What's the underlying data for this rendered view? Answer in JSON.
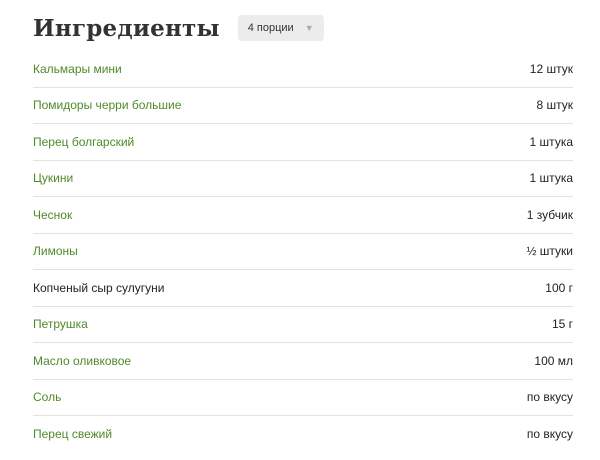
{
  "header": {
    "title": "Ингредиенты",
    "portions": {
      "selected": "4 порции",
      "arrow_icon": "triangle-down-icon"
    }
  },
  "colors": {
    "link_green": "#4e8a2a",
    "plain_text": "#222222",
    "divider": "#e2e2e2",
    "dropdown_bg": "#ececec"
  },
  "ingredients": [
    {
      "name": "Кальмары мини",
      "amount": "12 штук",
      "link": true
    },
    {
      "name": "Помидоры черри большие",
      "amount": "8 штук",
      "link": true
    },
    {
      "name": "Перец болгарский",
      "amount": "1 штука",
      "link": true
    },
    {
      "name": "Цукини",
      "amount": "1 штука",
      "link": true
    },
    {
      "name": "Чеснок",
      "amount": "1 зубчик",
      "link": true
    },
    {
      "name": "Лимоны",
      "amount": "½ штуки",
      "link": true
    },
    {
      "name": "Копченый сыр сулугуни",
      "amount": "100 г",
      "link": false
    },
    {
      "name": "Петрушка",
      "amount": "15 г",
      "link": true
    },
    {
      "name": "Масло оливковое",
      "amount": "100 мл",
      "link": true
    },
    {
      "name": "Соль",
      "amount": "по вкусу",
      "link": true
    },
    {
      "name": "Перец свежий",
      "amount": "по вкусу",
      "link": true
    }
  ]
}
